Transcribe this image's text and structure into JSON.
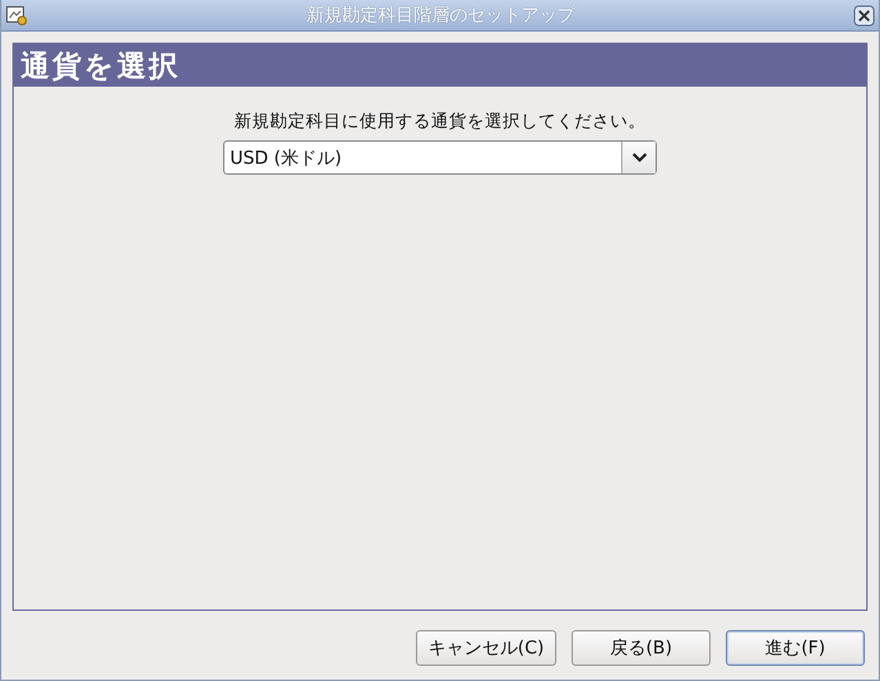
{
  "window": {
    "title": "新規勘定科目階層のセットアップ"
  },
  "page": {
    "heading": "通貨を選択",
    "prompt": "新規勘定科目に使用する通貨を選択してください。",
    "currency": {
      "value": "USD (米ドル)"
    }
  },
  "buttons": [
    {
      "label": "キャンセル(C)",
      "focused": false
    },
    {
      "label": "戻る(B)",
      "focused": false
    },
    {
      "label": "進む(F)",
      "focused": true
    }
  ]
}
